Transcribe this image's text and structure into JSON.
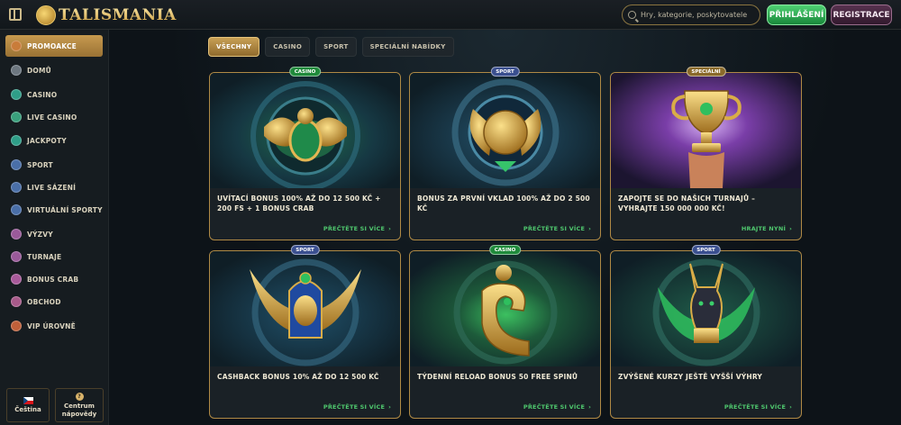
{
  "header": {
    "logo_text": "TALISMANIA",
    "search_placeholder": "Hry, kategorie, poskytovatele",
    "login_label": "PŘIHLÁŠENÍ",
    "register_label": "REGISTRACE"
  },
  "sidebar": {
    "items": [
      {
        "label": "PROMOAKCE",
        "icon": "gift-icon",
        "color": "#c97c3a"
      },
      {
        "label": "DOMŮ",
        "icon": "home-icon",
        "color": "#6d7780"
      },
      {
        "label": "CASINO",
        "icon": "casino-icon",
        "color": "#2f9e88"
      },
      {
        "label": "LIVE CASINO",
        "icon": "live-casino-icon",
        "color": "#3aa07c"
      },
      {
        "label": "JACKPOTY",
        "icon": "jackpot-icon",
        "color": "#2f9e88"
      },
      {
        "label": "SPORT",
        "icon": "sport-icon",
        "color": "#4a6fa8"
      },
      {
        "label": "LIVE SÁZENÍ",
        "icon": "live-betting-icon",
        "color": "#4a6fa8"
      },
      {
        "label": "VIRTUÁLNÍ SPORTY",
        "icon": "virtual-sports-icon",
        "color": "#4a6fa8"
      },
      {
        "label": "VÝZVY",
        "icon": "challenges-icon",
        "color": "#9a5a9a"
      },
      {
        "label": "TURNAJE",
        "icon": "tournaments-icon",
        "color": "#9a5a9a"
      },
      {
        "label": "BONUS CRAB",
        "icon": "bonus-crab-icon",
        "color": "#a85a9a"
      },
      {
        "label": "OBCHOD",
        "icon": "shop-icon",
        "color": "#a85a8a"
      },
      {
        "label": "VIP ÚROVNĚ",
        "icon": "vip-icon",
        "color": "#c0603a"
      }
    ],
    "language_label": "Čeština",
    "help_label_1": "Centrum",
    "help_label_2": "nápovědy"
  },
  "filters": [
    {
      "label": "VŠECHNY",
      "active": true
    },
    {
      "label": "CASINO",
      "active": false
    },
    {
      "label": "SPORT",
      "active": false
    },
    {
      "label": "SPECIÁLNÍ NABÍDKY",
      "active": false
    }
  ],
  "cards": [
    {
      "badge": "CASINO",
      "title": "UVÍTACÍ BONUS 100% AŽ DO 12 500 KČ + 200 FS + 1 BONUS CRAB",
      "link": "PŘEČTĚTE SI VÍCE",
      "art": "scarab-icon"
    },
    {
      "badge": "SPORT",
      "title": "BONUS ZA PRVNÍ VKLAD 100% AŽ DO 2 500 KČ",
      "link": "PŘEČTĚTE SI VÍCE",
      "art": "winged-ball-icon"
    },
    {
      "badge": "SPECIÁLNÍ",
      "title": "ZAPOJTE SE DO NAŠICH TURNAJŮ – VYHRAJTE 150 000 000 KČ!",
      "link": "HRAJTE NYNÍ",
      "art": "trophy-icon"
    },
    {
      "badge": "SPORT",
      "title": "CASHBACK BONUS 10% AŽ DO 12 500 KČ",
      "link": "PŘEČTĚTE SI VÍCE",
      "art": "winged-goddess-icon"
    },
    {
      "badge": "CASINO",
      "title": "TÝDENNÍ RELOAD BONUS 50 FREE SPINŮ",
      "link": "PŘEČTĚTE SI VÍCE",
      "art": "horus-icon"
    },
    {
      "badge": "SPORT",
      "title": "ZVÝŠENÉ KURZY JEŠTĚ VYŠŠÍ VÝHRY",
      "link": "PŘEČTĚTE SI VÍCE",
      "art": "anubis-icon"
    }
  ]
}
